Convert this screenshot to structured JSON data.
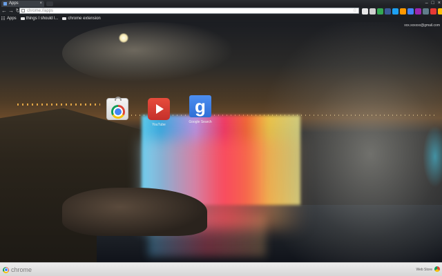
{
  "tab": {
    "title": "Apps",
    "close_glyph": "×"
  },
  "window_controls": [
    "–",
    "□",
    "×"
  ],
  "nav": {
    "back": "←",
    "forward": "→",
    "reload": "↻"
  },
  "omnibox": {
    "url": "chrome://apps",
    "star": "☆"
  },
  "extensions": [
    {
      "name": "ext-icon-1",
      "color": "#e8e8e8"
    },
    {
      "name": "ext-icon-2",
      "color": "#d0d0d0"
    },
    {
      "name": "ext-icon-3",
      "color": "#34a853"
    },
    {
      "name": "ext-icon-4",
      "color": "#3b5998"
    },
    {
      "name": "ext-icon-5",
      "color": "#1da1f2"
    },
    {
      "name": "ext-icon-6",
      "color": "#ff9800"
    },
    {
      "name": "ext-icon-7",
      "color": "#4285f4"
    },
    {
      "name": "ext-icon-8",
      "color": "#9c27b0"
    },
    {
      "name": "ext-icon-9",
      "color": "#607d8b"
    },
    {
      "name": "ext-icon-10",
      "color": "#e53935"
    },
    {
      "name": "ext-icon-11",
      "color": "#fbbc05"
    },
    {
      "name": "ext-icon-12",
      "color": "#c62828"
    },
    {
      "name": "ext-icon-13",
      "color": "#d81b60"
    }
  ],
  "bookmarks": {
    "apps_label": "Apps",
    "items": [
      {
        "label": "things I should l..."
      },
      {
        "label": "chrome extension"
      }
    ]
  },
  "account": {
    "email": "xxx.xxxxxx@gmail.com"
  },
  "apps": [
    {
      "name": "chrome-web-store",
      "label": ""
    },
    {
      "name": "youtube",
      "label": "YouTube"
    },
    {
      "name": "google-search",
      "label": "Google Search"
    }
  ],
  "footer": {
    "brand": "chrome",
    "webstore_link": "Web Store"
  }
}
